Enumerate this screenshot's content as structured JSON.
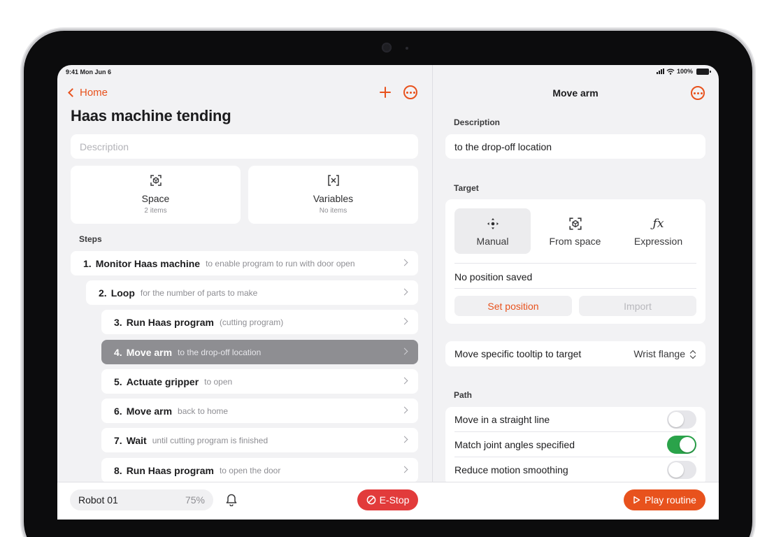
{
  "status_bar": {
    "time": "9:41",
    "date": "Mon Jun 6",
    "battery": "100%"
  },
  "left": {
    "back_label": "Home",
    "title": "Haas machine tending",
    "description_placeholder": "Description",
    "cards": [
      {
        "icon": "space-icon",
        "title": "Space",
        "subtitle": "2 items"
      },
      {
        "icon": "variables-icon",
        "title": "Variables",
        "subtitle": "No items"
      }
    ],
    "steps_label": "Steps",
    "steps": [
      {
        "num": "1.",
        "name": "Monitor Haas machine",
        "sub": "to enable program to run with door open"
      },
      {
        "num": "2.",
        "name": "Loop",
        "sub": "for the number of parts to make"
      },
      {
        "num": "3.",
        "name": "Run Haas program",
        "sub": "(cutting program)"
      },
      {
        "num": "4.",
        "name": "Move arm",
        "sub": "to the drop-off location",
        "selected": true
      },
      {
        "num": "5.",
        "name": "Actuate gripper",
        "sub": "to open"
      },
      {
        "num": "6.",
        "name": "Move arm",
        "sub": "back to home"
      },
      {
        "num": "7.",
        "name": "Wait",
        "sub": "until cutting program is finished"
      },
      {
        "num": "8.",
        "name": "Run Haas program",
        "sub": "to open the door"
      }
    ]
  },
  "right": {
    "title": "Move arm",
    "description_label": "Description",
    "description_value": "to the drop-off location",
    "target_label": "Target",
    "target_modes": [
      {
        "icon": "move-arrows-icon",
        "label": "Manual",
        "active": true
      },
      {
        "icon": "space-icon",
        "label": "From space"
      },
      {
        "icon": "function-icon",
        "label": "Expression"
      }
    ],
    "no_position": "No position saved",
    "set_position": "Set position",
    "import": "Import",
    "tooltip_label": "Move specific tooltip to target",
    "tooltip_value": "Wrist flange",
    "path_label": "Path",
    "path_options": [
      {
        "label": "Move in a straight line",
        "on": false
      },
      {
        "label": "Match joint angles specified",
        "on": true
      },
      {
        "label": "Reduce motion smoothing",
        "on": false
      }
    ]
  },
  "bottom": {
    "robot_name": "Robot 01",
    "robot_percent": "75%",
    "estop_label": "E-Stop",
    "play_label": "Play routine"
  },
  "colors": {
    "accent": "#e8521d",
    "estop": "#e23b3b",
    "toggle_on": "#2aa34a",
    "selected_step": "#8e8e92"
  }
}
